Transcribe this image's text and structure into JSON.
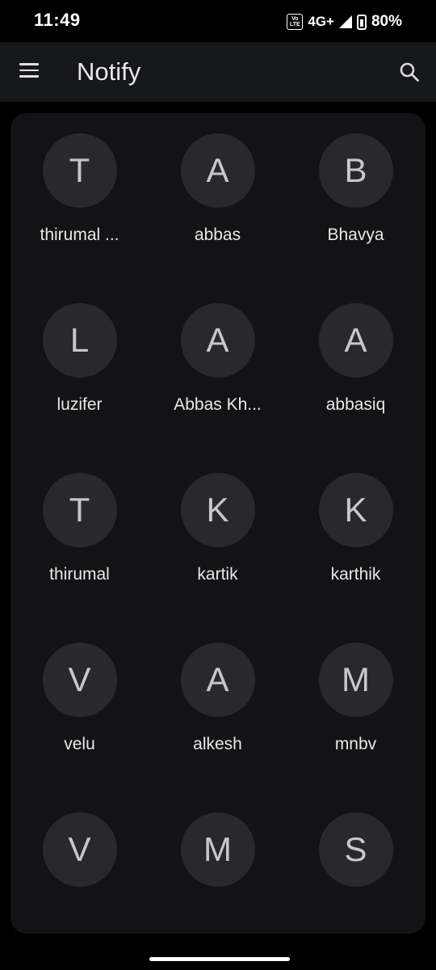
{
  "status_bar": {
    "time": "11:49",
    "volte_label": "Vo LTE",
    "network": "4G+",
    "battery": "80%"
  },
  "app_bar": {
    "menu_icon": "hamburger-menu-icon",
    "title": "Notify",
    "search_icon": "search-icon"
  },
  "contacts": [
    {
      "initial": "T",
      "name": "thirumal ..."
    },
    {
      "initial": "A",
      "name": "abbas"
    },
    {
      "initial": "B",
      "name": "Bhavya"
    },
    {
      "initial": "L",
      "name": "luzifer"
    },
    {
      "initial": "A",
      "name": "Abbas Kh..."
    },
    {
      "initial": "A",
      "name": "abbasiq"
    },
    {
      "initial": "T",
      "name": "thirumal"
    },
    {
      "initial": "K",
      "name": "kartik"
    },
    {
      "initial": "K",
      "name": "karthik"
    },
    {
      "initial": "V",
      "name": "velu"
    },
    {
      "initial": "A",
      "name": "alkesh"
    },
    {
      "initial": "M",
      "name": "mnbv"
    },
    {
      "initial": "V",
      "name": ""
    },
    {
      "initial": "M",
      "name": ""
    },
    {
      "initial": "S",
      "name": ""
    }
  ],
  "colors": {
    "background": "#000000",
    "app_bar": "#16171b",
    "card": "#131316",
    "avatar": "#29292c"
  }
}
